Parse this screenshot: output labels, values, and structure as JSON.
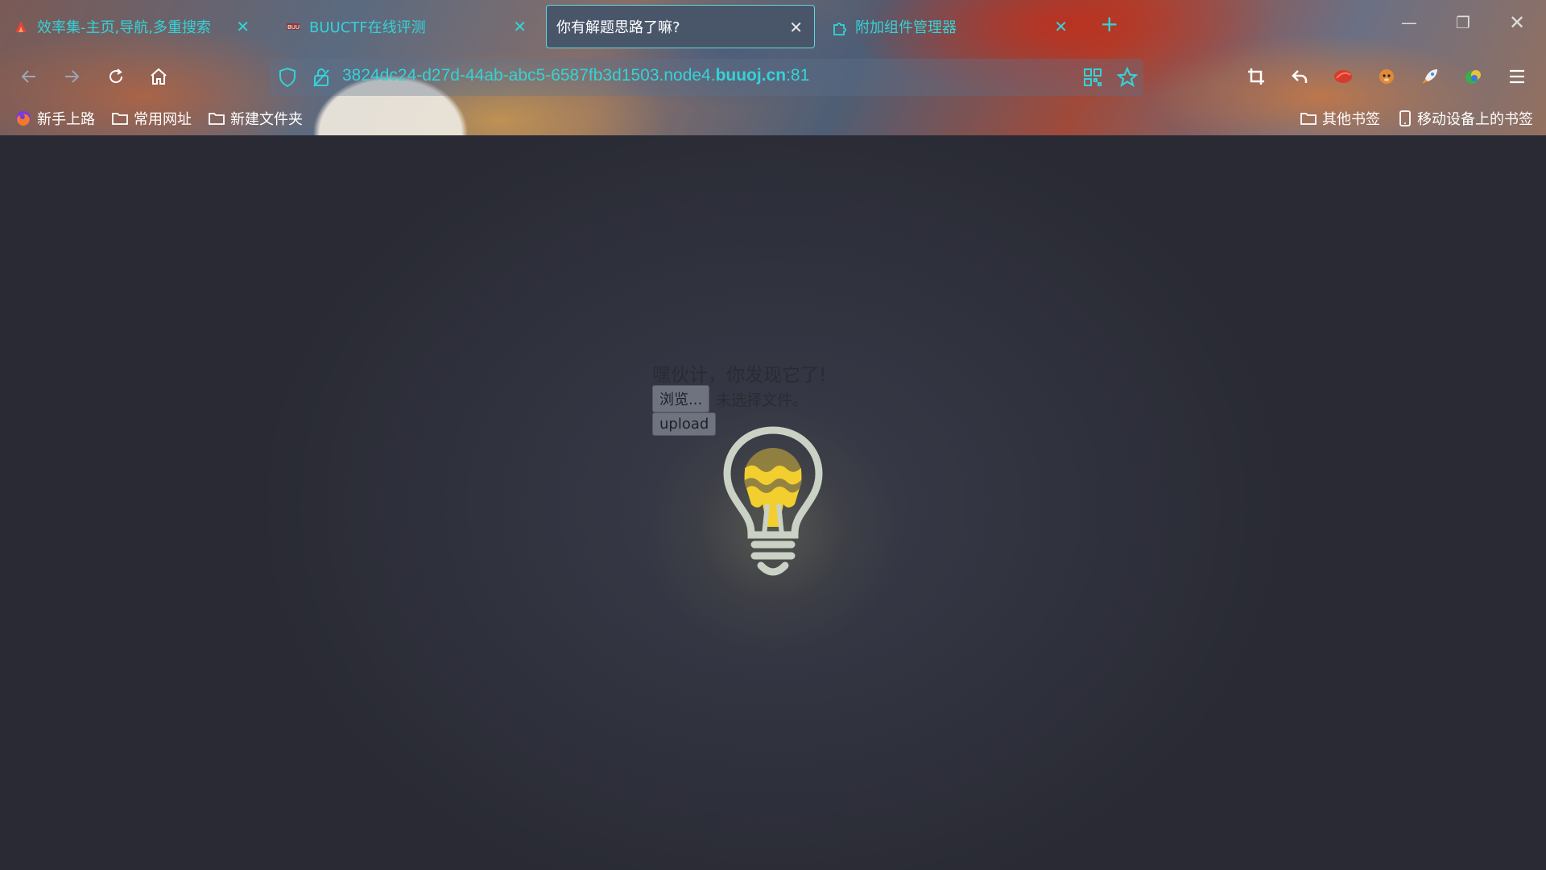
{
  "tabs": [
    {
      "title": "效率集-主页,导航,多重搜索",
      "active": false
    },
    {
      "title": "BUUCTF在线评测",
      "active": false
    },
    {
      "title": "你有解题思路了嘛?",
      "active": true
    },
    {
      "title": "附加组件管理器",
      "active": false
    }
  ],
  "url": {
    "prefix": "3824dc24-d27d-44ab-abc5-6587fb3d1503.node4.",
    "domain": "buuoj.cn",
    "port": ":81"
  },
  "bookmarks": {
    "left": [
      "新手上路",
      "常用网址",
      "新建文件夹"
    ],
    "right": [
      "其他书签",
      "移动设备上的书签"
    ]
  },
  "page": {
    "hint": "嘿伙计，你发现它了!",
    "browse_label": "浏览...",
    "no_file_label": "未选择文件。",
    "upload_label": "upload"
  },
  "colors": {
    "accent": "#33d3d8",
    "page_bg": "#2d2f3a",
    "bulb_yellow": "#f2cf2e",
    "bulb_outline": "#c9d2c4"
  }
}
